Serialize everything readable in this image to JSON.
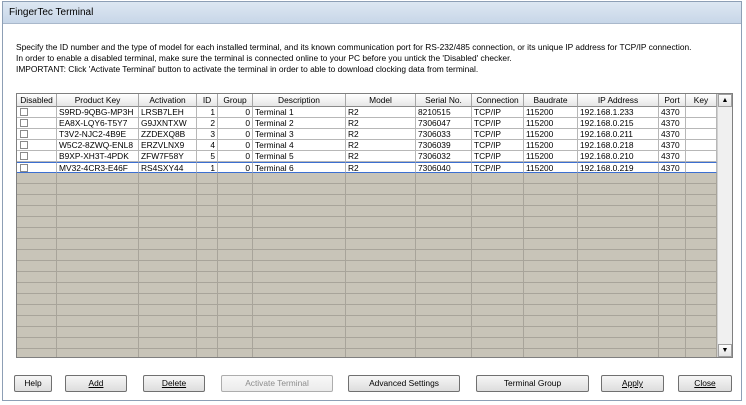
{
  "window": {
    "title": "FingerTec Terminal"
  },
  "instructions": [
    "Specify the ID number and the type of model for each installed terminal, and its known communication port for RS-232/485 connection, or its unique IP address for TCP/IP connection.",
    "In order to enable a disabled terminal, make sure the terminal is connected online to your PC before you untick the 'Disabled' checker.",
    "IMPORTANT: Click 'Activate Terminal' button to activate the terminal in order to able to download clocking data from terminal."
  ],
  "table": {
    "columns": [
      "Disabled",
      "Product Key",
      "Activation",
      "ID",
      "Group",
      "Description",
      "Model",
      "Serial No.",
      "Connection",
      "Baudrate",
      "IP Address",
      "Port",
      "Key"
    ],
    "rows": [
      {
        "disabled": false,
        "product_key": "S9RD-9QBG-MP3H",
        "activation": "LRSB7LEH",
        "id": "1",
        "group": "0",
        "description": "Terminal 1",
        "model": "R2",
        "serial": "8210515",
        "connection": "TCP/IP",
        "baudrate": "115200",
        "ip": "192.168.1.233",
        "port": "4370",
        "key": ""
      },
      {
        "disabled": false,
        "product_key": "EA8X-LQY6-T5Y7",
        "activation": "G9JXNTXW",
        "id": "2",
        "group": "0",
        "description": "Terminal 2",
        "model": "R2",
        "serial": "7306047",
        "connection": "TCP/IP",
        "baudrate": "115200",
        "ip": "192.168.0.215",
        "port": "4370",
        "key": ""
      },
      {
        "disabled": false,
        "product_key": "T3V2-NJC2-4B9E",
        "activation": "ZZDEXQ8B",
        "id": "3",
        "group": "0",
        "description": "Terminal 3",
        "model": "R2",
        "serial": "7306033",
        "connection": "TCP/IP",
        "baudrate": "115200",
        "ip": "192.168.0.211",
        "port": "4370",
        "key": ""
      },
      {
        "disabled": false,
        "product_key": "W5C2-8ZWQ-ENL8",
        "activation": "ERZVLNX9",
        "id": "4",
        "group": "0",
        "description": "Terminal 4",
        "model": "R2",
        "serial": "7306039",
        "connection": "TCP/IP",
        "baudrate": "115200",
        "ip": "192.168.0.218",
        "port": "4370",
        "key": ""
      },
      {
        "disabled": false,
        "product_key": "B9XP-XH3T-4PDK",
        "activation": "ZFW7F58Y",
        "id": "5",
        "group": "0",
        "description": "Terminal 5",
        "model": "R2",
        "serial": "7306032",
        "connection": "TCP/IP",
        "baudrate": "115200",
        "ip": "192.168.0.210",
        "port": "4370",
        "key": ""
      },
      {
        "disabled": false,
        "product_key": "MV32-4CR3-E46F",
        "activation": "RS4SXY44",
        "id": "1",
        "group": "0",
        "description": "Terminal 6",
        "model": "R2",
        "serial": "7306040",
        "connection": "TCP/IP",
        "baudrate": "115200",
        "ip": "192.168.0.219",
        "port": "4370",
        "key": ""
      }
    ]
  },
  "buttons": {
    "help": "Help",
    "add": "Add",
    "delete": "Delete",
    "activate": "Activate Terminal",
    "advanced": "Advanced Settings",
    "terminal_group": "Terminal Group",
    "apply": "Apply",
    "close": "Close"
  },
  "scrollbar": {
    "up_icon": "▲",
    "down_icon": "▼"
  }
}
